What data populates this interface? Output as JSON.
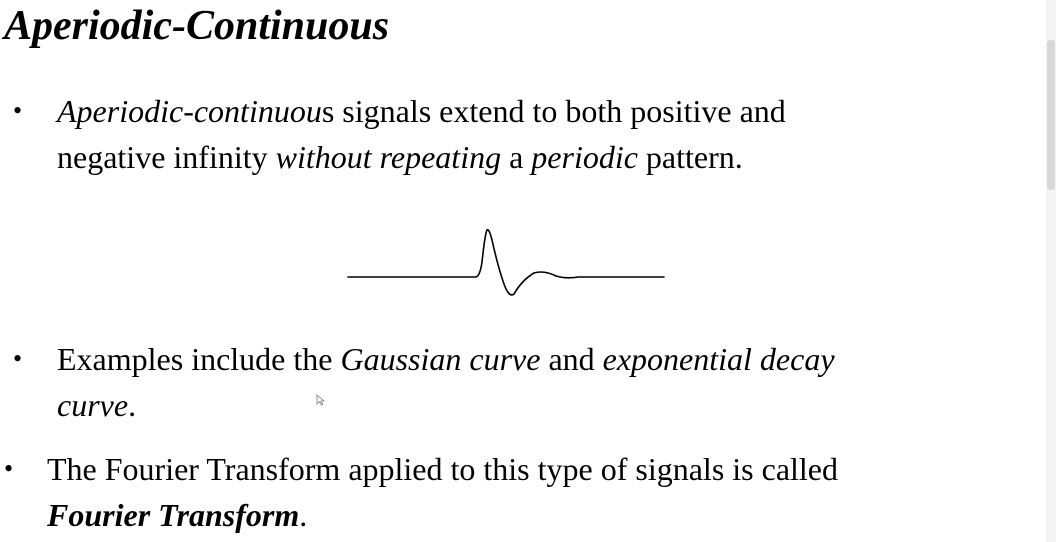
{
  "slide": {
    "title": "Aperiodic-Continuous",
    "bullets": [
      {
        "mark": "•",
        "line1": {
          "t1": "Aperiodic-continuou",
          "t2": "s signals extend to both positive and"
        },
        "line2": {
          "t1": "negative infinity ",
          "t2": "without repeating",
          "t3": " a ",
          "t4": "periodic",
          "t5": " pattern."
        }
      },
      {
        "mark": "•",
        "line1": {
          "t1": "Examples include the ",
          "t2": "Gaussian curve",
          "t3": " and ",
          "t4": "exponential decay"
        },
        "line2": {
          "t1": "curve",
          "t2": "."
        }
      },
      {
        "mark": "•",
        "line1": {
          "t1": "The Fourier Transform applied to this type of signals is called"
        },
        "line2": {
          "t1": "Fourier Transform",
          "t2": "."
        }
      }
    ],
    "figure_icon": "aperiodic-signal-waveform"
  }
}
